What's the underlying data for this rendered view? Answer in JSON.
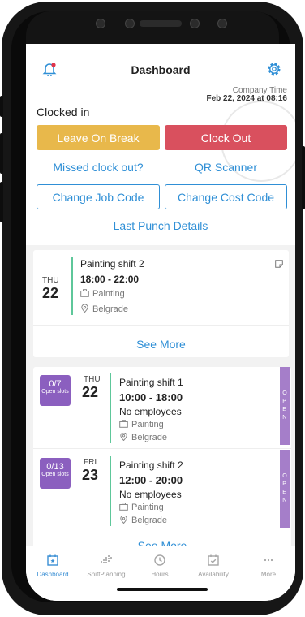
{
  "header": {
    "title": "Dashboard",
    "company_time_label": "Company Time",
    "company_time_value": "Feb 22, 2024 at 08:16",
    "status": "Clocked in"
  },
  "actions": {
    "leave_on_break": "Leave On Break",
    "clock_out": "Clock Out",
    "missed_clock_out": "Missed clock out?",
    "qr_scanner": "QR Scanner",
    "change_job_code": "Change Job Code",
    "change_cost_code": "Change Cost Code",
    "last_punch_details": "Last Punch Details"
  },
  "my_shift": {
    "day": "THU",
    "date": "22",
    "name": "Painting shift 2",
    "time": "18:00 - 22:00",
    "position": "Painting",
    "location": "Belgrade",
    "see_more": "See More"
  },
  "open_shifts": [
    {
      "slots": "0/7",
      "slots_label": "Open slots",
      "day": "THU",
      "date": "22",
      "name": "Painting shift 1",
      "time": "10:00 - 18:00",
      "employees": "No employees",
      "position": "Painting",
      "location": "Belgrade",
      "tag": "OPEN"
    },
    {
      "slots": "0/13",
      "slots_label": "Open slots",
      "day": "FRI",
      "date": "23",
      "name": "Painting shift 2",
      "time": "12:00 - 20:00",
      "employees": "No employees",
      "position": "Painting",
      "location": "Belgrade",
      "tag": "OPEN"
    }
  ],
  "open_see_more": "See More",
  "tabs": [
    {
      "label": "Dashboard",
      "icon": "dashboard-icon"
    },
    {
      "label": "ShiftPlanning",
      "icon": "shift-planning-icon"
    },
    {
      "label": "Hours",
      "icon": "clock-icon"
    },
    {
      "label": "Availability",
      "icon": "calendar-check-icon"
    },
    {
      "label": "More",
      "icon": "more-icon"
    }
  ],
  "colors": {
    "accent_blue": "#2f8fd6",
    "break_yellow": "#e8b84b",
    "clock_out_red": "#d9505e",
    "open_purple": "#8b5fbf",
    "shift_green": "#5ec79a"
  }
}
